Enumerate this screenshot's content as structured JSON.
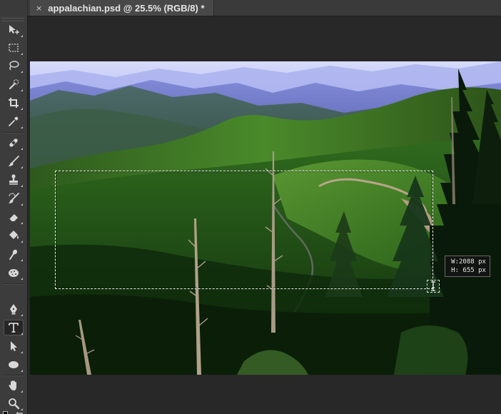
{
  "document": {
    "tab_title": "appalachian.psd @ 25.5% (RGB/8) *",
    "close_glyph": "×"
  },
  "tools": [
    {
      "name": "move-tool",
      "icon": "move-icon"
    },
    {
      "name": "rectangular-marquee-tool",
      "icon": "marquee-icon"
    },
    {
      "name": "lasso-tool",
      "icon": "lasso-icon"
    },
    {
      "name": "quick-selection-tool",
      "icon": "quick-selection-icon"
    },
    {
      "name": "crop-tool",
      "icon": "crop-icon"
    },
    {
      "name": "eyedropper-tool",
      "icon": "eyedropper-icon"
    },
    {
      "name": "spot-healing-brush-tool",
      "icon": "bandage-icon"
    },
    {
      "name": "brush-tool",
      "icon": "brush-icon"
    },
    {
      "name": "clone-stamp-tool",
      "icon": "stamp-icon"
    },
    {
      "name": "history-brush-tool",
      "icon": "history-brush-icon"
    },
    {
      "name": "eraser-tool",
      "icon": "eraser-icon"
    },
    {
      "name": "paint-bucket-tool",
      "icon": "bucket-icon"
    },
    {
      "name": "smudge-tool",
      "icon": "smudge-icon"
    },
    {
      "name": "sponge-tool",
      "icon": "sponge-icon"
    },
    {
      "name": "pen-tool",
      "icon": "pen-icon"
    },
    {
      "name": "type-tool",
      "icon": "type-icon",
      "active": true
    },
    {
      "name": "path-selection-tool",
      "icon": "arrow-icon"
    },
    {
      "name": "ellipse-tool",
      "icon": "ellipse-icon"
    },
    {
      "name": "hand-tool",
      "icon": "hand-icon"
    },
    {
      "name": "zoom-tool",
      "icon": "zoom-icon"
    }
  ],
  "selection_hud": {
    "width_label": "W:",
    "width_value": "2088 px",
    "height_label": "H:",
    "height_value": "655 px"
  },
  "colors": {
    "panel_bg": "#3c3c3c",
    "canvas_bg": "#282828",
    "tab_active_bg": "#484848",
    "foreground_color": "#ffffff"
  }
}
